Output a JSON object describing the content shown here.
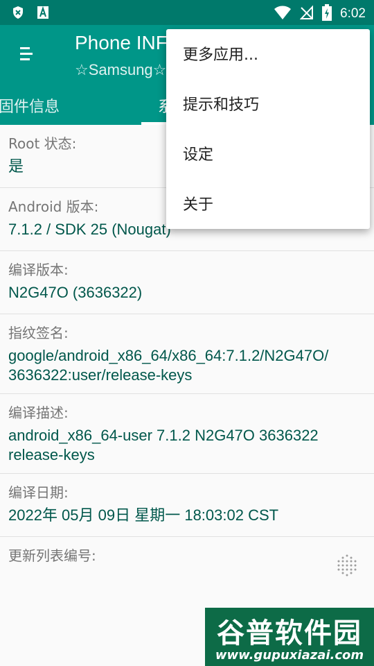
{
  "status_bar": {
    "time": "6:02",
    "icons": [
      "shield-x-icon",
      "font-a-icon",
      "wifi-icon",
      "no-signal-icon",
      "battery-charging-icon"
    ]
  },
  "app_bar": {
    "title": "Phone INF",
    "subtitle": "☆Samsung☆",
    "menu_icon": "hamburger-menu-icon"
  },
  "tabs": [
    {
      "label": "固件信息"
    },
    {
      "label": "系"
    }
  ],
  "rows": [
    {
      "label": "Root 状态:",
      "value": "是"
    },
    {
      "label": "Android 版本:",
      "value": "7.1.2 / SDK 25 (Nougat)"
    },
    {
      "label": "编译版本:",
      "value": "N2G47O (3636322)"
    },
    {
      "label": "指纹签名:",
      "value": "google/android_x86_64/x86_64:7.1.2/N2G47O/\n3636322:user/release-keys"
    },
    {
      "label": "编译描述:",
      "value": "android_x86_64-user 7.1.2 N2G47O 3636322\nrelease-keys"
    },
    {
      "label": "编译日期:",
      "value": "2022年 05月 09日 星期一 18:03:02 CST"
    },
    {
      "label": "更新列表编号:",
      "value": ""
    }
  ],
  "popup_menu": {
    "items": [
      "更多应用...",
      "提示和技巧",
      "设定",
      "关于"
    ]
  },
  "watermark": {
    "line1": "谷普软件园",
    "line2": "www.gupuxiazai.com"
  },
  "colors": {
    "status_bar": "#00796b",
    "app_bar": "#009688",
    "value_text": "#00574b",
    "label_text": "#757575"
  }
}
